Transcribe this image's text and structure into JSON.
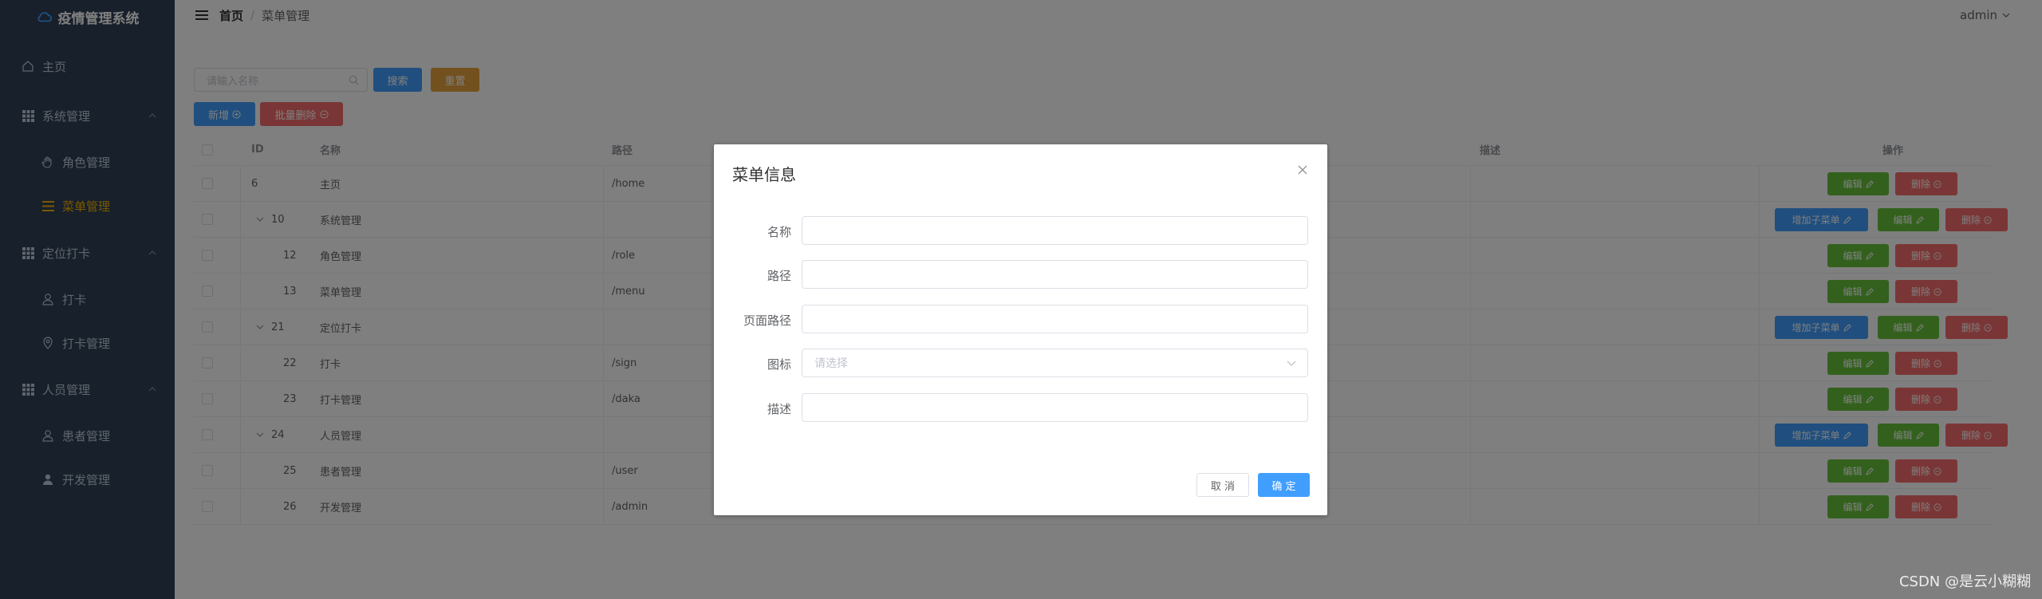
{
  "app": {
    "title": "疫情管理系统"
  },
  "sidebar": {
    "items": [
      {
        "label": "主页",
        "icon": "home-icon",
        "type": "top"
      },
      {
        "label": "系统管理",
        "icon": "grid-icon",
        "type": "group"
      },
      {
        "label": "角色管理",
        "icon": "hand-icon",
        "type": "sub"
      },
      {
        "label": "菜单管理",
        "icon": "list-icon",
        "type": "sub",
        "active": true
      },
      {
        "label": "定位打卡",
        "icon": "grid-icon",
        "type": "group"
      },
      {
        "label": "打卡",
        "icon": "user-icon",
        "type": "sub"
      },
      {
        "label": "打卡管理",
        "icon": "location-icon",
        "type": "sub"
      },
      {
        "label": "人员管理",
        "icon": "grid-icon",
        "type": "group"
      },
      {
        "label": "患者管理",
        "icon": "user-icon",
        "type": "sub"
      },
      {
        "label": "开发管理",
        "icon": "user-solid-icon",
        "type": "sub"
      }
    ]
  },
  "header": {
    "breadcrumb_home": "首页",
    "breadcrumb_sep": "/",
    "breadcrumb_current": "菜单管理",
    "user": "admin"
  },
  "toolbar": {
    "search_placeholder": "请输入名称",
    "search_btn": "搜索",
    "reset_btn": "重置",
    "add_btn": "新增",
    "batch_delete_btn": "批量删除"
  },
  "table": {
    "headers": {
      "id": "ID",
      "name": "名称",
      "path": "路径",
      "desc": "描述",
      "ops": "操作"
    },
    "rows": [
      {
        "id": "6",
        "name": "主页",
        "path": "/home",
        "level": 0,
        "expandable": false,
        "has_add": false
      },
      {
        "id": "10",
        "name": "系统管理",
        "path": "",
        "level": 0,
        "expandable": true,
        "has_add": true
      },
      {
        "id": "12",
        "name": "角色管理",
        "path": "/role",
        "level": 1,
        "expandable": false,
        "has_add": false
      },
      {
        "id": "13",
        "name": "菜单管理",
        "path": "/menu",
        "level": 1,
        "expandable": false,
        "has_add": false
      },
      {
        "id": "21",
        "name": "定位打卡",
        "path": "",
        "level": 0,
        "expandable": true,
        "has_add": true
      },
      {
        "id": "22",
        "name": "打卡",
        "path": "/sign",
        "level": 1,
        "expandable": false,
        "has_add": false
      },
      {
        "id": "23",
        "name": "打卡管理",
        "path": "/daka",
        "level": 1,
        "expandable": false,
        "has_add": false
      },
      {
        "id": "24",
        "name": "人员管理",
        "path": "",
        "level": 0,
        "expandable": true,
        "has_add": true
      },
      {
        "id": "25",
        "name": "患者管理",
        "path": "/user",
        "level": 1,
        "expandable": false,
        "has_add": false
      },
      {
        "id": "26",
        "name": "开发管理",
        "path": "/admin",
        "level": 1,
        "expandable": false,
        "has_add": false
      }
    ],
    "add_child_label": "增加子菜单",
    "edit_label": "编辑",
    "delete_label": "删除"
  },
  "dialog": {
    "title": "菜单信息",
    "fields": {
      "name": "名称",
      "path": "路径",
      "page_path": "页面路径",
      "icon": "图标",
      "desc": "描述"
    },
    "icon_placeholder": "请选择",
    "cancel": "取 消",
    "confirm": "确 定"
  },
  "watermark": "CSDN @是云小糊糊",
  "colors": {
    "sidebar": "#304156",
    "primary": "#409eff",
    "success": "#67c23a",
    "danger": "#f56c6c",
    "warning": "#e6a23c",
    "active": "#f4b400"
  }
}
